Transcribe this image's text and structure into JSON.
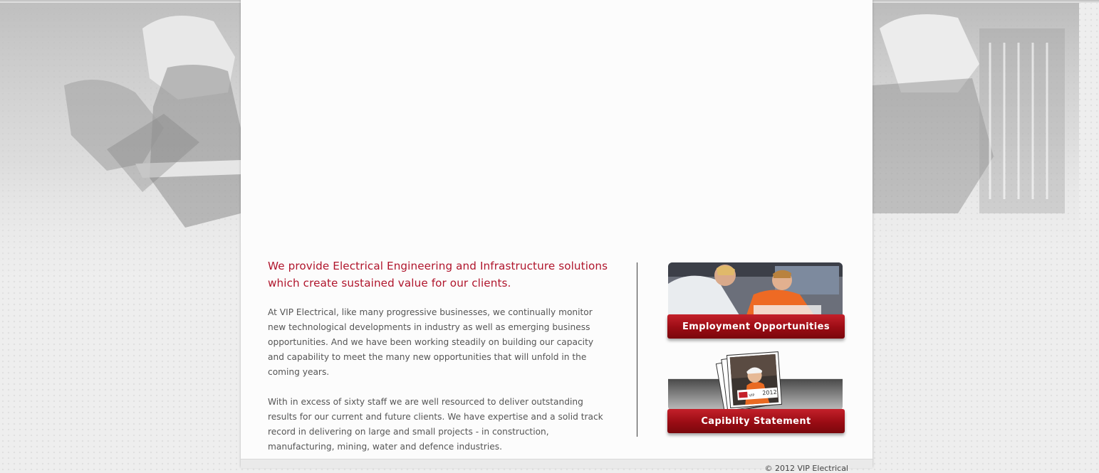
{
  "colors": {
    "accent": "#b0152c",
    "button": "#9a0c14",
    "body_text": "#555555",
    "page_bg": "#eeeeee",
    "content_bg": "#fcfcfc"
  },
  "background": {
    "left_photo": "electrician-working-photo",
    "right_photo": "electrician-switchboard-photo"
  },
  "intro": {
    "headline": "We provide Electrical Engineering and Infrastructure solutions which create sustained value for our clients.",
    "paragraph_1": "At VIP Electrical, like many progressive businesses, we continually monitor new technological developments in industry as well as emerging business opportunities. And we have been working steadily on building our capacity and capability to meet the many new opportunities that will unfold in the coming years.",
    "paragraph_2": "With in excess of sixty staff we are well resourced to deliver outstanding results for our current and future clients. We have expertise and a solid track record in delivering on large and small projects - in construction, manufacturing, mining, water and defence industries."
  },
  "promos": {
    "employment": {
      "label": "Employment Opportunities",
      "image": "workers-photo"
    },
    "capability": {
      "label": "Capiblity Statement",
      "image": "brochure-stack-photo",
      "brochure_year": "2012",
      "brochure_brand": "VIP"
    }
  },
  "footer": {
    "copyright": "© 2012 VIP Electrical"
  }
}
